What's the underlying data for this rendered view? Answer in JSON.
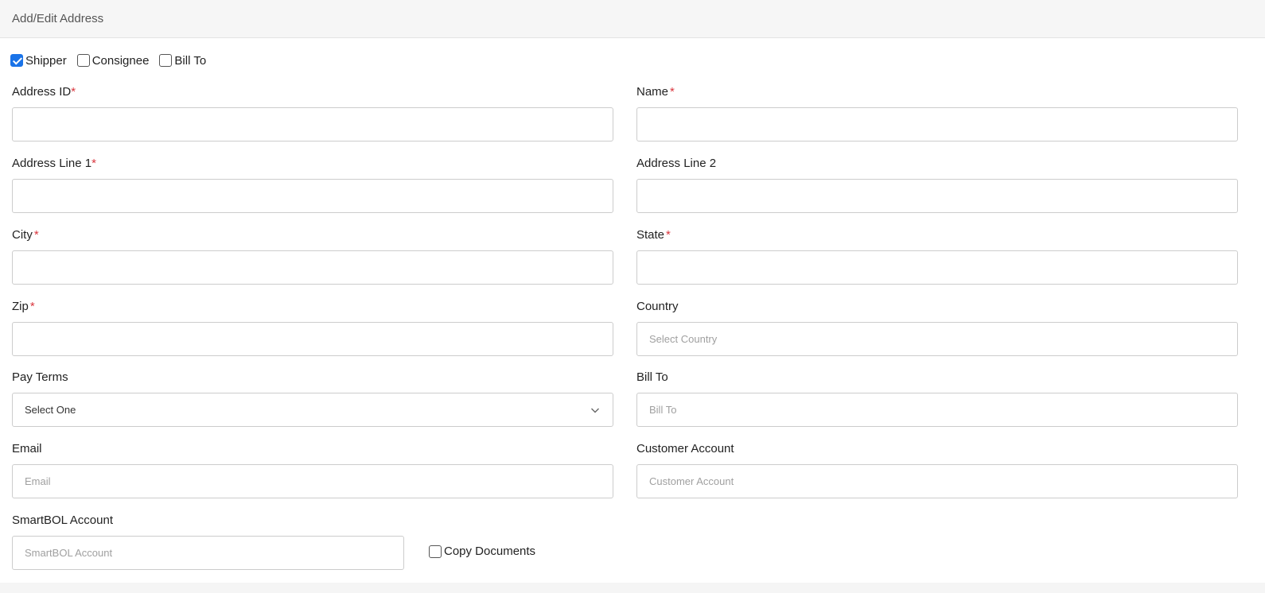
{
  "header": {
    "title": "Add/Edit Address"
  },
  "roles": [
    {
      "label": "Shipper",
      "checked": true
    },
    {
      "label": "Consignee",
      "checked": false
    },
    {
      "label": "Bill To",
      "checked": false
    }
  ],
  "form": {
    "address_id": {
      "label": "Address ID",
      "required_mark": "*",
      "value": ""
    },
    "name": {
      "label": "Name",
      "required_mark": "*",
      "value": ""
    },
    "address_line1": {
      "label": "Address Line 1",
      "required_mark": "*",
      "value": ""
    },
    "address_line2": {
      "label": "Address Line 2",
      "value": ""
    },
    "city": {
      "label": "City",
      "required_mark": "*",
      "value": ""
    },
    "state": {
      "label": "State",
      "required_mark": "*",
      "value": ""
    },
    "zip": {
      "label": "Zip",
      "required_mark": "*",
      "value": ""
    },
    "country": {
      "label": "Country",
      "placeholder": "Select Country"
    },
    "pay_terms": {
      "label": "Pay Terms",
      "selected": "Select One"
    },
    "bill_to": {
      "label": "Bill To",
      "placeholder": "Bill To"
    },
    "email": {
      "label": "Email",
      "placeholder": "Email"
    },
    "customer_account": {
      "label": "Customer Account",
      "placeholder": "Customer Account"
    },
    "smartbol_account": {
      "label": "SmartBOL Account",
      "placeholder": "SmartBOL Account"
    },
    "copy_documents": {
      "label": "Copy Documents",
      "checked": false
    }
  },
  "colors": {
    "accent": "#1a73e8",
    "required": "#d9363e",
    "header_bg": "#f6f6f6",
    "border": "#cccccc"
  },
  "icons": {
    "pay_terms_dropdown": "chevron-down-icon"
  }
}
